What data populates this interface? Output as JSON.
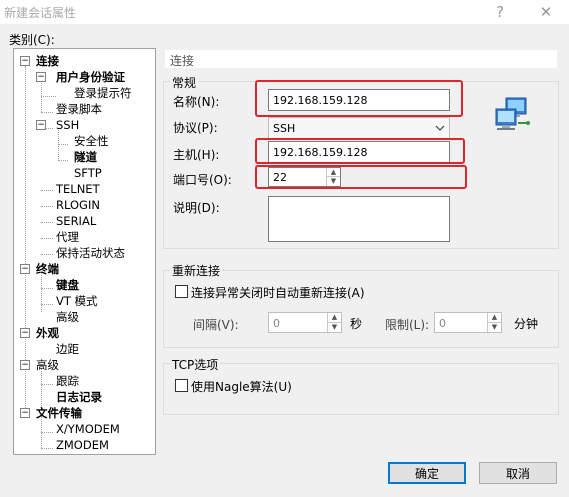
{
  "window": {
    "title": "新建会话属性",
    "help_glyph": "?",
    "close_glyph": "✕"
  },
  "category_label": "类别(C):",
  "tree": [
    {
      "label": "连接",
      "bold": true,
      "toggle": "−"
    },
    {
      "label": "用户身份验证",
      "bold": true,
      "toggle": "−"
    },
    {
      "label": "登录提示符"
    },
    {
      "label": "登录脚本"
    },
    {
      "label": "SSH",
      "toggle": "−"
    },
    {
      "label": "安全性"
    },
    {
      "label": "隧道",
      "bold": true
    },
    {
      "label": "SFTP"
    },
    {
      "label": "TELNET"
    },
    {
      "label": "RLOGIN"
    },
    {
      "label": "SERIAL"
    },
    {
      "label": "代理"
    },
    {
      "label": "保持活动状态"
    },
    {
      "label": "终端",
      "bold": true,
      "toggle": "−"
    },
    {
      "label": "键盘",
      "bold": true
    },
    {
      "label": "VT 模式"
    },
    {
      "label": "高级"
    },
    {
      "label": "外观",
      "bold": true,
      "toggle": "−"
    },
    {
      "label": "边距"
    },
    {
      "label": "高级",
      "toggle": "−"
    },
    {
      "label": "跟踪"
    },
    {
      "label": "日志记录",
      "bold": true
    },
    {
      "label": "文件传输",
      "bold": true,
      "toggle": "−"
    },
    {
      "label": "X/YMODEM"
    },
    {
      "label": "ZMODEM"
    }
  ],
  "panel": {
    "header": "连接",
    "general": {
      "legend": "常规",
      "name_label": "名称(N):",
      "name_value": "192.168.159.128",
      "protocol_label": "协议(P):",
      "protocol_value": "SSH",
      "host_label": "主机(H):",
      "host_value": "192.168.159.128",
      "port_label": "端口号(O):",
      "port_value": "22",
      "desc_label": "说明(D):",
      "desc_value": ""
    },
    "reconnect": {
      "legend": "重新连接",
      "auto_label": "连接异常关闭时自动重新连接(A)",
      "auto_checked": false,
      "interval_label": "间隔(V):",
      "interval_value": "0",
      "interval_unit": "秒",
      "limit_label": "限制(L):",
      "limit_value": "0",
      "limit_unit": "分钟"
    },
    "tcp": {
      "legend": "TCP选项",
      "nagle_label": "使用Nagle算法(U)",
      "nagle_checked": false
    }
  },
  "buttons": {
    "ok": "确定",
    "cancel": "取消"
  },
  "colors": {
    "highlight_box": "#e0242c",
    "primary_border": "#0078d7"
  }
}
